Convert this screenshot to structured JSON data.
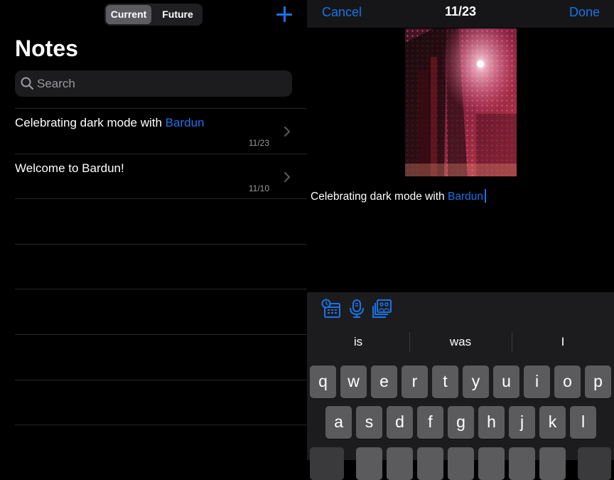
{
  "segments": {
    "current": "Current",
    "future": "Future"
  },
  "list": {
    "title": "Notes",
    "search_placeholder": "Search"
  },
  "notes": [
    {
      "title_prefix": "Celebrating dark mode with ",
      "title_link": "Bardun",
      "date": "11/23"
    },
    {
      "title_prefix": "Welcome to Bardun!",
      "title_link": "",
      "date": "11/10"
    }
  ],
  "editor": {
    "cancel": "Cancel",
    "title": "11/23",
    "done": "Done",
    "text_prefix": "Celebrating dark mode with ",
    "text_link": "Bardun"
  },
  "keyboard": {
    "suggestions": [
      "is",
      "was",
      "I"
    ],
    "row1": [
      "q",
      "w",
      "e",
      "r",
      "t",
      "y",
      "u",
      "i",
      "o",
      "p"
    ],
    "row2": [
      "a",
      "s",
      "d",
      "f",
      "g",
      "h",
      "j",
      "k",
      "l"
    ],
    "accessory_icons": [
      "calendar-clock-icon",
      "microphone-icon",
      "photo-library-icon"
    ]
  },
  "colors": {
    "accent": "#1a73e8",
    "background": "#000000",
    "key": "#5b5b5e"
  }
}
